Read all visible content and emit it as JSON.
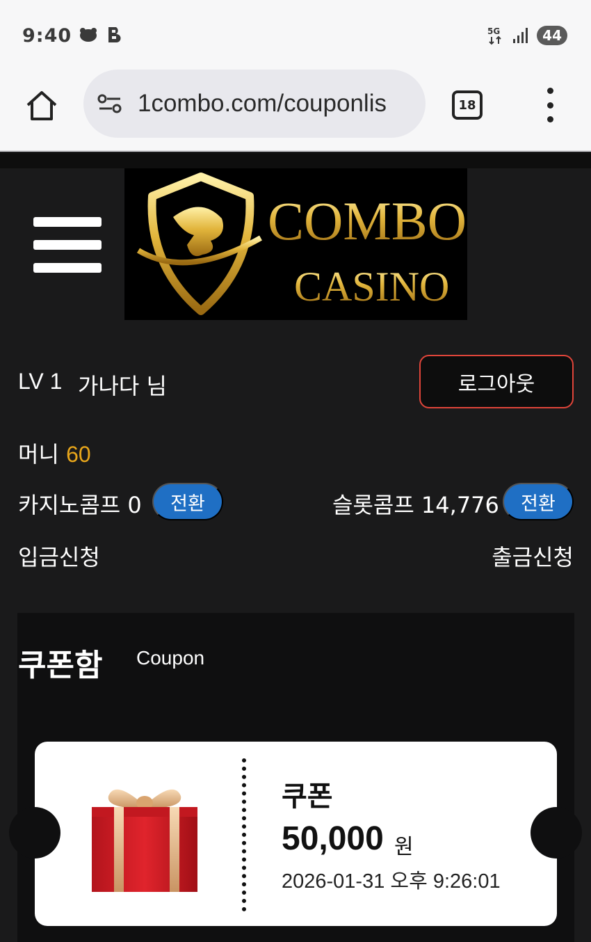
{
  "status_bar": {
    "time": "9:40",
    "network": "5G",
    "battery": "44"
  },
  "browser": {
    "url": "1combo.com/couponlis",
    "tab_count": "18"
  },
  "header": {
    "logo_text_line1": "COMBO",
    "logo_text_line2": "CASINO"
  },
  "user": {
    "level": "LV 1",
    "name": "가나다 님",
    "logout_label": "로그아웃",
    "money_label": "머니",
    "money_value": "60",
    "casino_comp": "카지노콤프 0",
    "slot_comp": "슬롯콤프 14,776",
    "convert_label": "전환",
    "deposit_label": "입금신청",
    "withdraw_label": "출금신청"
  },
  "coupon_box": {
    "title": "쿠폰함",
    "subtitle": "Coupon",
    "items": [
      {
        "name": "쿠폰",
        "amount": "50,000",
        "unit": "원",
        "date": "2026-01-31 오후 9:26:01"
      }
    ]
  },
  "colors": {
    "accent_gold": "#e8a61b",
    "convert_blue": "#1f6fc4",
    "logout_border": "#e0453a"
  }
}
